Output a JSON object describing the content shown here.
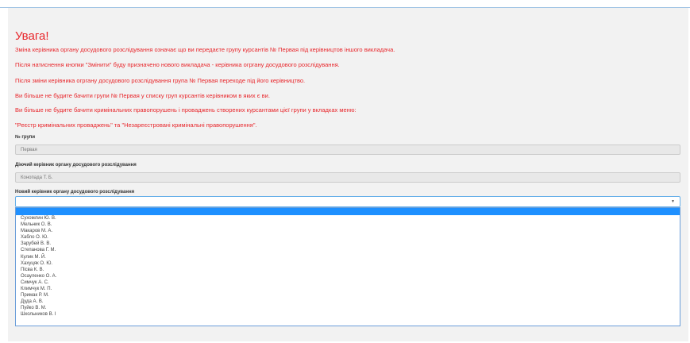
{
  "warning": {
    "title": "Увага!",
    "lines": [
      "Зміна керівника органу досудового розслідування означає що ви передаєте групу курсантів № Первая під керівництов іншого викладача.",
      "Після натиснення кнопки \"Змінити\" буду призначено нового викладача - керівника огргану досудового розслідування.",
      "Після зміни керівника огргану досудового розслідування група № Первая переходе під його керівництво.",
      "Ви більше не будите бачити групи № Первая у списку груп курсантів керівником в яких є ви.",
      "Ви більше не будите бачити кримінальних правопорушень і проваджень створених курсантами цієї групи у вкладках меню:",
      "\"Реєстр кримінальних проваджень\" та \"Незареєстровані кримінальні правопорушення\"."
    ]
  },
  "form": {
    "group_label": "№ групи",
    "group_value": "Первая",
    "current_label": "Діючий керівник органу досудового розслідування",
    "current_value": "Конопада Т. Б.",
    "new_label": "Новий керівник органу досудового розслідування",
    "new_value": ""
  },
  "dropdown": {
    "options": [
      "Сухомлин Ю. В.",
      "Мельник О. В.",
      "Макаров М. А.",
      "Хабло О. Ю.",
      "Зарубей В. В.",
      "Степанова Г. М.",
      "Кулик М. Й.",
      "Хахуцяк О. Ю.",
      "Пісва К. В.",
      "Осауленко О. А.",
      "Симчук А. С.",
      "Климчук М. П.",
      "Примак Р. М.",
      "Дуда А. В.",
      "Пуйко В. М.",
      "Школьников В. І"
    ]
  },
  "colors": {
    "warning": "#e8262b",
    "highlight": "#1e90ff",
    "focus_border": "#66afe9"
  },
  "icons": {
    "select_arrow": "chevron-down-icon"
  }
}
